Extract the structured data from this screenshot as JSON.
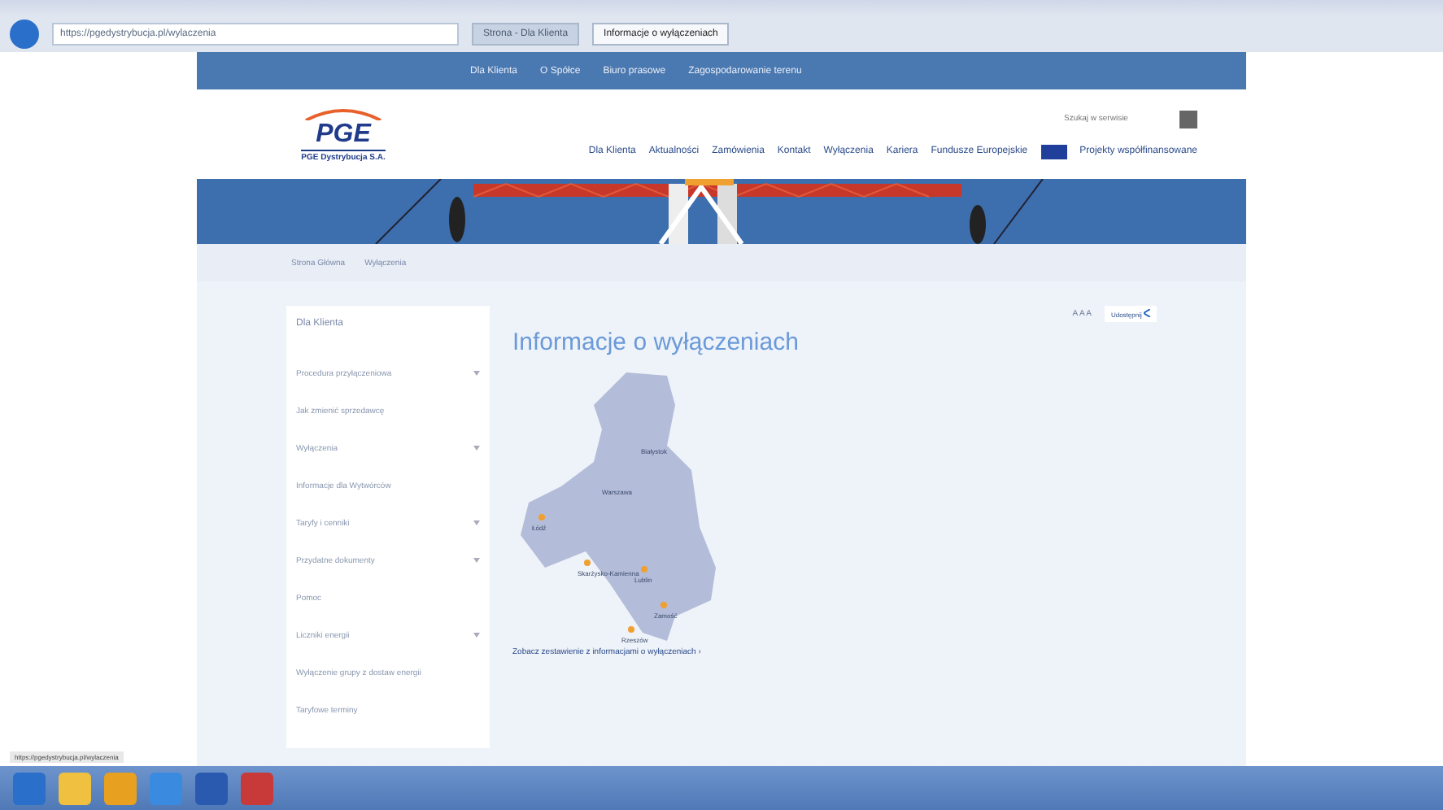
{
  "browser": {
    "address": "https://pgedystrybucja.pl/wylaczenia",
    "tabs": [
      {
        "label": "Strona - Dla Klienta",
        "selected": false
      },
      {
        "label": "Informacje o wyłączeniach",
        "selected": true
      }
    ]
  },
  "top_nav": [
    "Dla Klienta",
    "O Spółce",
    "Biuro prasowe",
    "Zagospodarowanie terenu"
  ],
  "logo": {
    "mark": "PGE",
    "company": "PGE Dystrybucja S.A."
  },
  "search": {
    "placeholder": "Szukaj w serwisie"
  },
  "main_nav": [
    "Dla Klienta",
    "Aktualności",
    "Zamówienia",
    "Kontakt",
    "Wyłączenia",
    "Kariera",
    "Fundusze Europejskie",
    "Projekty współfinansowane"
  ],
  "breadcrumb": [
    "Strona Główna",
    "Wyłączenia"
  ],
  "sidebar": {
    "title": "Dla Klienta",
    "items": [
      {
        "label": "Procedura przyłączeniowa",
        "expandable": true
      },
      {
        "label": "Jak zmienić sprzedawcę",
        "expandable": false
      },
      {
        "label": "Wyłączenia",
        "expandable": true
      },
      {
        "label": "Informacje dla Wytwórców",
        "expandable": false
      },
      {
        "label": "Taryfy i cenniki",
        "expandable": true
      },
      {
        "label": "Przydatne dokumenty",
        "expandable": true
      },
      {
        "label": "Pomoc",
        "expandable": false
      },
      {
        "label": "Liczniki energii",
        "expandable": true
      },
      {
        "label": "Wyłączenie grupy z dostaw energii",
        "expandable": false
      },
      {
        "label": "Taryfowe terminy",
        "expandable": false
      }
    ]
  },
  "font_sizes": "A A A",
  "share": "Udostępnij",
  "page_title": "Informacje o wyłączeniach",
  "map": {
    "cities": [
      {
        "name": "Białystok",
        "marker": false
      },
      {
        "name": "Warszawa",
        "marker": false
      },
      {
        "name": "Łódź",
        "marker": true
      },
      {
        "name": "Skarżysko-Kamienna",
        "marker": true
      },
      {
        "name": "Lublin",
        "marker": true
      },
      {
        "name": "Zamość",
        "marker": true
      },
      {
        "name": "Rzeszów",
        "marker": true
      }
    ]
  },
  "summary_link": "Zobacz zestawienie z informacjami o wyłączeniach ›",
  "status_url": "https://pgedystrybucja.pl/wylaczenia"
}
